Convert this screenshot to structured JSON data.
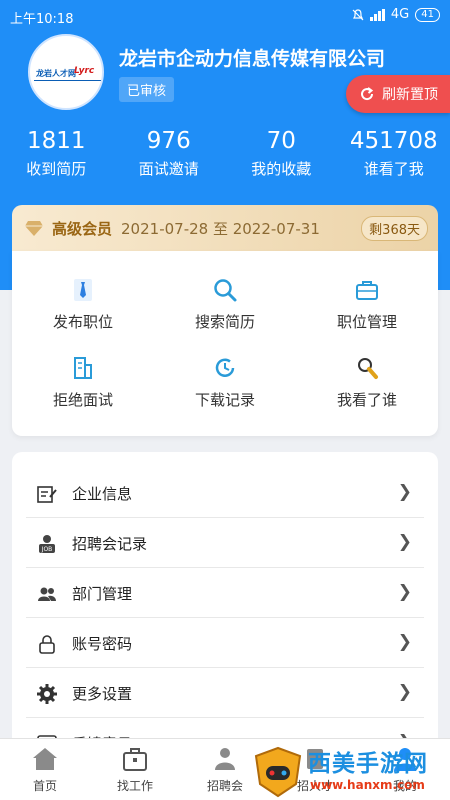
{
  "status_bar": {
    "time": "上午10:18",
    "network": "4G",
    "battery": "41"
  },
  "company": {
    "name": "龙岩市企动力信息传媒有限公司",
    "badge": "已审核",
    "logo_text_1": "龙岩人才网",
    "logo_text_2": "Lyrc"
  },
  "refresh_label": "刷新置顶",
  "stats": [
    {
      "value": "1811",
      "label": "收到简历"
    },
    {
      "value": "976",
      "label": "面试邀请"
    },
    {
      "value": "70",
      "label": "我的收藏"
    },
    {
      "value": "451708",
      "label": "谁看了我"
    }
  ],
  "vip": {
    "title": "高级会员",
    "dates": "2021-07-28 至 2022-07-31",
    "remaining": "剩368天"
  },
  "grid": [
    {
      "label": "发布职位",
      "icon": "tie-icon"
    },
    {
      "label": "搜索简历",
      "icon": "search-icon"
    },
    {
      "label": "职位管理",
      "icon": "briefcase-icon"
    },
    {
      "label": "拒绝面试",
      "icon": "building-icon"
    },
    {
      "label": "下载记录",
      "icon": "clock-icon"
    },
    {
      "label": "我看了谁",
      "icon": "magnifier-person-icon"
    }
  ],
  "menu": [
    {
      "label": "企业信息",
      "icon": "edit-doc-icon"
    },
    {
      "label": "招聘会记录",
      "icon": "job-icon"
    },
    {
      "label": "部门管理",
      "icon": "people-icon"
    },
    {
      "label": "账号密码",
      "icon": "lock-icon"
    },
    {
      "label": "更多设置",
      "icon": "gear-icon"
    },
    {
      "label": "反馈意见",
      "icon": "feedback-icon"
    }
  ],
  "chevron": "❯",
  "tabs": [
    {
      "label": "首页",
      "icon": "home-icon"
    },
    {
      "label": "找工作",
      "icon": "briefcase-icon"
    },
    {
      "label": "招聘会",
      "icon": "people-icon"
    },
    {
      "label": "招人才",
      "icon": "talent-icon"
    },
    {
      "label": "我的",
      "icon": "user-icon"
    }
  ],
  "watermark": {
    "text": "西美手游网",
    "url": "www.hanxm.com"
  },
  "colors": {
    "primary": "#1f8ef7",
    "refresh": "#ef4f4f",
    "vip_text": "#9a6614"
  }
}
